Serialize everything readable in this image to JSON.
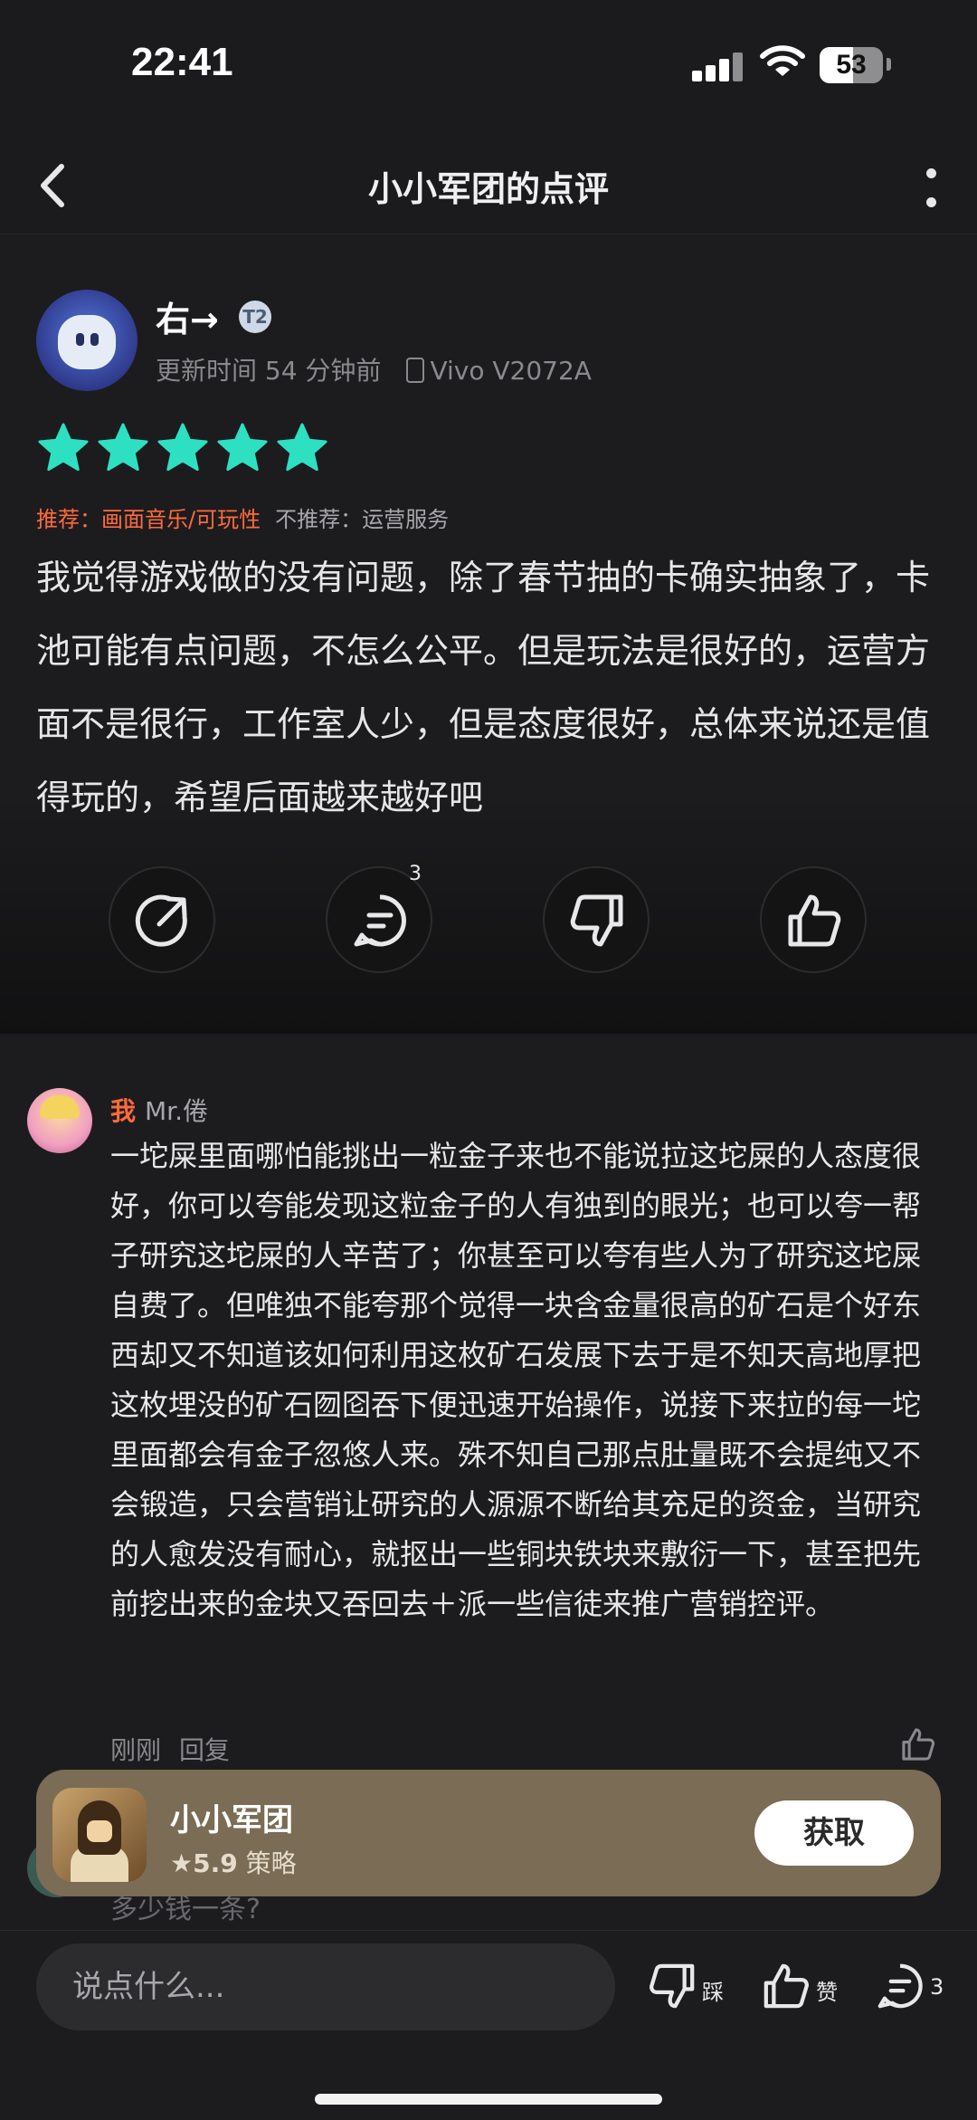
{
  "status_bar": {
    "time": "22:41",
    "battery": "53",
    "battery_level": 0.53
  },
  "nav": {
    "title": "小小军团的点评"
  },
  "review": {
    "username": "右→",
    "badge": "T2",
    "updated": "更新时间 54 分钟前",
    "device": "Vivo V2072A",
    "rating": 5,
    "recommend_label": "推荐：",
    "recommend": "画面音乐/可玩性",
    "not_recommend_label": "不推荐：",
    "not_recommend": "运营服务",
    "text": "我觉得游戏做的没有问题，除了春节抽的卡确实抽象了，卡池可能有点问题，不怎么公平。但是玩法是很好的，运营方面不是很行，工作室人少，但是态度很好，总体来说还是值得玩的，希望后面越来越好吧",
    "actions": [
      {
        "icon": "share-icon",
        "count": ""
      },
      {
        "icon": "comment-icon",
        "count": "3"
      },
      {
        "icon": "dislike-icon",
        "count": ""
      },
      {
        "icon": "like-icon",
        "count": ""
      }
    ]
  },
  "comment": {
    "me_label": "我",
    "author": "Mr.倦",
    "text": "一坨屎里面哪怕能挑出一粒金子来也不能说拉这坨屎的人态度很好，你可以夸能发现这粒金子的人有独到的眼光；也可以夸一帮子研究这坨屎的人辛苦了；你甚至可以夸有些人为了研究这坨屎自费了。但唯独不能夸那个觉得一块含金量很高的矿石是个好东西却又不知道该如何利用这枚矿石发展下去于是不知天高地厚把这枚埋没的矿石囫囵吞下便迅速开始操作，说接下来拉的每一坨里面都会有金子忽悠人来。殊不知自己那点肚量既不会提纯又不会锻造，只会营销让研究的人源源不断给其充足的资金，当研究的人愈发没有耐心，就抠出一些铜块铁块来敷衍一下，甚至把先前挖出来的金块又吞回去＋派一些信徒来推广营销控评。",
    "time": "刚刚",
    "reply": "回复"
  },
  "next_comment": {
    "text": "多少钱一条?"
  },
  "app_card": {
    "name": "小小军团",
    "score": "5.9",
    "category": "策略",
    "get_label": "获取"
  },
  "bottom_bar": {
    "input_placeholder": "说点什么...",
    "dislike_label": "踩",
    "like_label": "赞",
    "comment_count": "3"
  },
  "colors": {
    "star": "#2ee0c2",
    "accent": "#ff6a3d",
    "card": "#7a6c55"
  }
}
